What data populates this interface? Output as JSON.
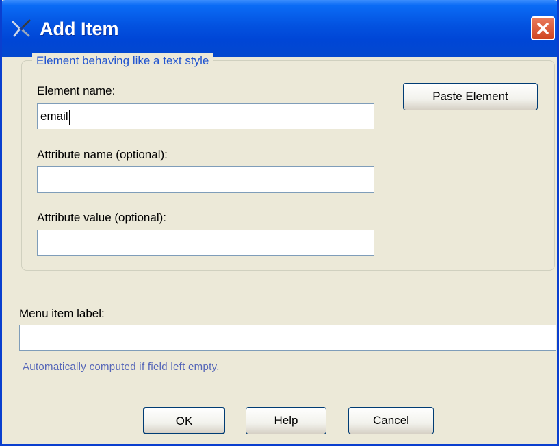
{
  "window": {
    "title": "Add Item",
    "icon": "app-x-icon",
    "close_icon": "close-icon"
  },
  "group": {
    "legend": "Element behaving like a text style",
    "element_name_label": "Element name:",
    "element_name_value": "email",
    "attribute_name_label": "Attribute name (optional):",
    "attribute_name_value": "",
    "attribute_value_label": "Attribute value (optional):",
    "attribute_value_value": "",
    "paste_button": "Paste Element"
  },
  "menu": {
    "label": "Menu item label:",
    "value": "",
    "hint": "Automatically computed if field left empty."
  },
  "buttons": {
    "ok": "OK",
    "help": "Help",
    "cancel": "Cancel"
  },
  "colors": {
    "titlebar": "#0352e0",
    "dialog_bg": "#ece9d8",
    "legend_text": "#2255d0",
    "hint_text": "#5566b8",
    "close_button": "#d0451f"
  }
}
